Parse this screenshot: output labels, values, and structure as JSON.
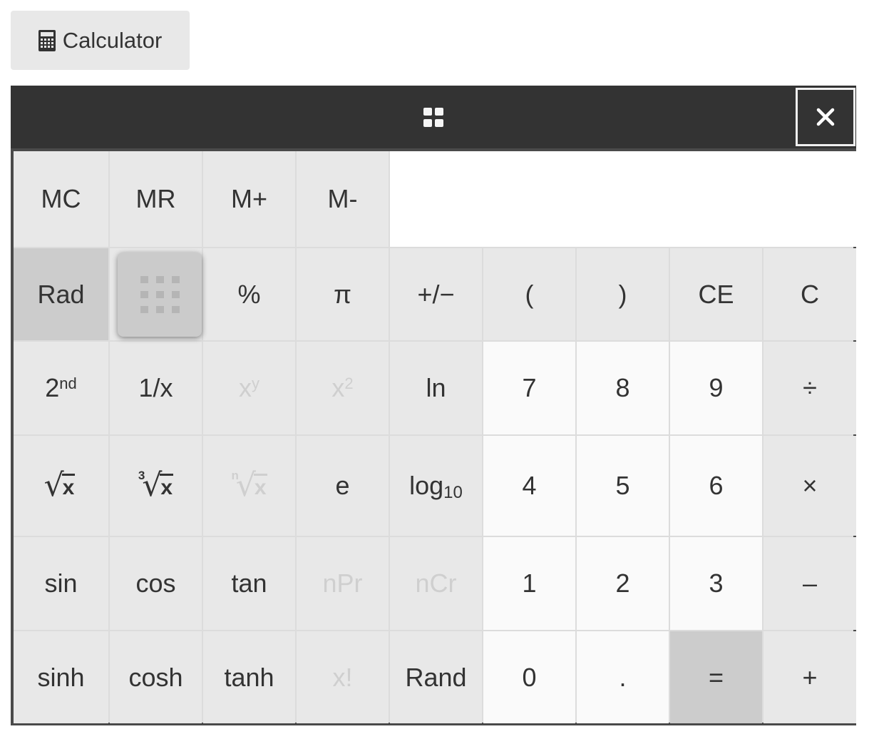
{
  "launcher": {
    "label": "Calculator",
    "icon": "calculator-icon"
  },
  "header": {
    "drag_icon": "drag-handle-icon",
    "close_icon": "close-icon"
  },
  "display": {
    "value": ""
  },
  "memory_row": [
    "MC",
    "MR",
    "M+",
    "M-"
  ],
  "rows": [
    [
      {
        "label": "Rad",
        "type": "dark"
      },
      {
        "label": "",
        "type": "drag-tile"
      },
      {
        "label": "%"
      },
      {
        "label": "π"
      },
      {
        "label": "+/−"
      },
      {
        "label": "("
      },
      {
        "label": ")"
      },
      {
        "label": "CE"
      },
      {
        "label": "C"
      }
    ],
    [
      {
        "label": "2",
        "sup": "nd"
      },
      {
        "label": "1/x"
      },
      {
        "label": "x",
        "sup": "y",
        "disabled": true
      },
      {
        "label": "x",
        "sup": "2",
        "disabled": true
      },
      {
        "label": "ln"
      },
      {
        "label": "7",
        "type": "num"
      },
      {
        "label": "8",
        "type": "num"
      },
      {
        "label": "9",
        "type": "num"
      },
      {
        "label": "÷"
      }
    ],
    [
      {
        "root": "",
        "arg": "x"
      },
      {
        "root": "3",
        "arg": "x"
      },
      {
        "root": "n",
        "arg": "x",
        "disabled": true
      },
      {
        "label": "e"
      },
      {
        "label": "log",
        "sub": "10"
      },
      {
        "label": "4",
        "type": "num"
      },
      {
        "label": "5",
        "type": "num"
      },
      {
        "label": "6",
        "type": "num"
      },
      {
        "label": "×"
      }
    ],
    [
      {
        "label": "sin"
      },
      {
        "label": "cos"
      },
      {
        "label": "tan"
      },
      {
        "label": "nPr",
        "disabled": true
      },
      {
        "label": "nCr",
        "disabled": true
      },
      {
        "label": "1",
        "type": "num"
      },
      {
        "label": "2",
        "type": "num"
      },
      {
        "label": "3",
        "type": "num"
      },
      {
        "label": "–"
      }
    ],
    [
      {
        "label": "sinh"
      },
      {
        "label": "cosh"
      },
      {
        "label": "tanh"
      },
      {
        "label": "x!",
        "disabled": true
      },
      {
        "label": "Rand"
      },
      {
        "label": "0",
        "type": "num"
      },
      {
        "label": ".",
        "type": "num"
      },
      {
        "label": "=",
        "type": "dark"
      },
      {
        "label": "+"
      }
    ]
  ],
  "key_names": [
    [
      "angle-mode-button",
      "empty-drag-slot",
      "percent-button",
      "pi-button",
      "sign-toggle-button",
      "open-paren-button",
      "close-paren-button",
      "clear-entry-button",
      "clear-button"
    ],
    [
      "second-function-button",
      "reciprocal-button",
      "power-button",
      "square-button",
      "natural-log-button",
      "digit-7-button",
      "digit-8-button",
      "digit-9-button",
      "divide-button"
    ],
    [
      "square-root-button",
      "cube-root-button",
      "nth-root-button",
      "euler-button",
      "log10-button",
      "digit-4-button",
      "digit-5-button",
      "digit-6-button",
      "multiply-button"
    ],
    [
      "sin-button",
      "cos-button",
      "tan-button",
      "permutation-button",
      "combination-button",
      "digit-1-button",
      "digit-2-button",
      "digit-3-button",
      "subtract-button"
    ],
    [
      "sinh-button",
      "cosh-button",
      "tanh-button",
      "factorial-button",
      "random-button",
      "digit-0-button",
      "decimal-button",
      "equals-button",
      "add-button"
    ]
  ],
  "memory_names": [
    "memory-clear-button",
    "memory-recall-button",
    "memory-add-button",
    "memory-subtract-button"
  ],
  "colors": {
    "header_bg": "#333333",
    "border": "#4a4a4a",
    "key_bg": "#e8e8e8",
    "digit_bg": "#fafafa",
    "active_bg": "#cccccc",
    "disabled_text": "#cfcfcf"
  }
}
